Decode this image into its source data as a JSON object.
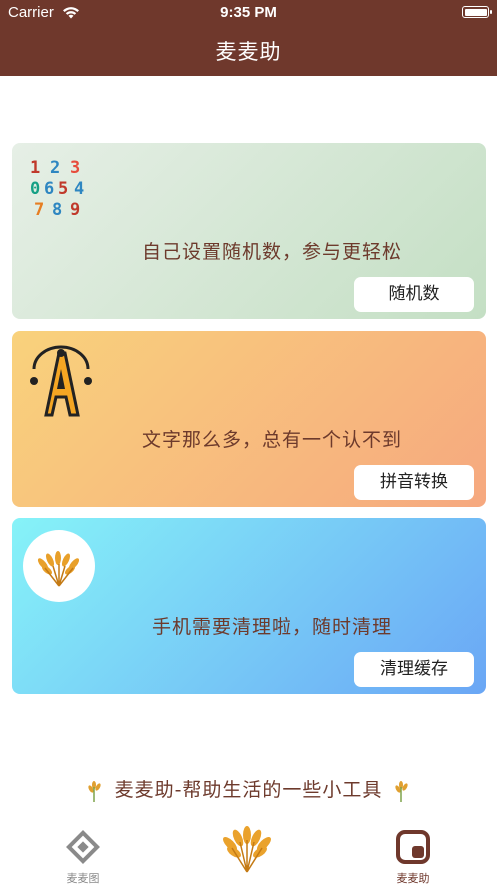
{
  "status_bar": {
    "carrier": "Carrier",
    "time": "9:35 PM"
  },
  "header": {
    "title": "麦麦助"
  },
  "cards": [
    {
      "description": "自己设置随机数，参与更轻松",
      "button": "随机数",
      "icon": "random-numbers-icon"
    },
    {
      "description": "文字那么多，总有一个认不到",
      "button": "拼音转换",
      "icon": "letter-a-icon"
    },
    {
      "description": "手机需要清理啦，随时清理",
      "button": "清理缓存",
      "icon": "wheat-icon"
    }
  ],
  "slogan": "麦麦助-帮助生活的一些小工具",
  "tabbar": {
    "left_label": "麦麦图",
    "right_label": "麦麦助",
    "active_color": "#6f382c",
    "inactive_color": "#8a8a8a"
  },
  "colors": {
    "brand": "#6f382c",
    "text": "#6d3a2c"
  }
}
